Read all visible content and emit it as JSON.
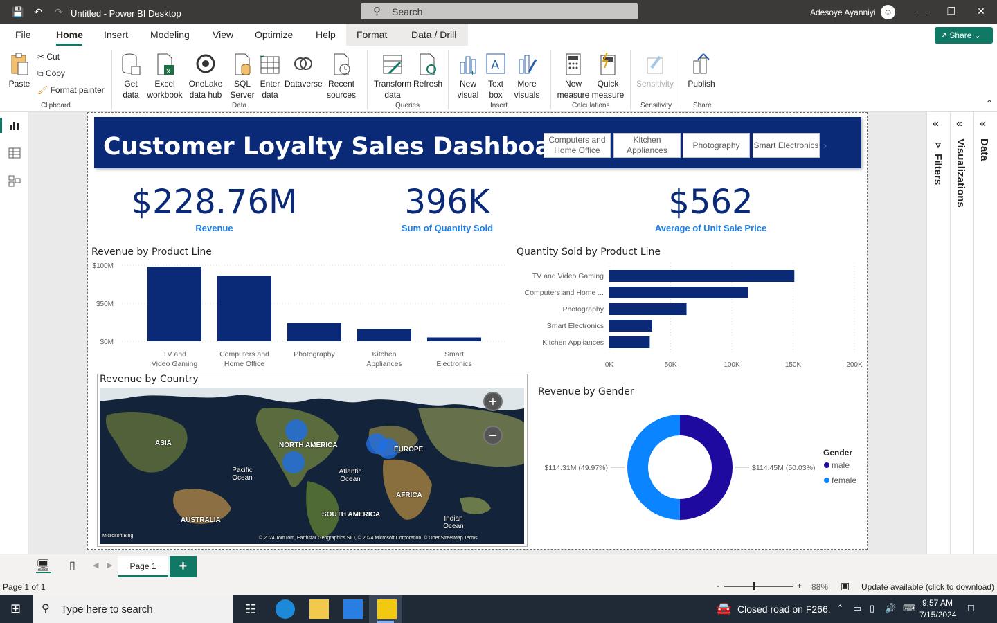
{
  "app": {
    "title": "Untitled - Power BI Desktop",
    "search_placeholder": "Search",
    "user": "Adesoye Ayanniyi"
  },
  "menu": {
    "items": [
      "File",
      "Home",
      "Insert",
      "Modeling",
      "View",
      "Optimize",
      "Help",
      "Format",
      "Data / Drill"
    ],
    "active": "Home",
    "share_label": "Share"
  },
  "ribbon": {
    "clipboard": {
      "paste": "Paste",
      "cut": "Cut",
      "copy": "Copy",
      "format_painter": "Format painter",
      "group": "Clipboard"
    },
    "data": {
      "get_data": "Get data",
      "excel": "Excel workbook",
      "onelake": "OneLake data hub",
      "sql": "SQL Server",
      "enter": "Enter data",
      "dataverse": "Dataverse",
      "recent": "Recent sources",
      "group": "Data"
    },
    "queries": {
      "transform": "Transform data",
      "refresh": "Refresh",
      "group": "Queries"
    },
    "insert": {
      "new_visual": "New visual",
      "text_box": "Text box",
      "more_visuals": "More visuals",
      "group": "Insert"
    },
    "calculations": {
      "new_measure": "New measure",
      "quick_measure": "Quick measure",
      "group": "Calculations"
    },
    "sensitivity": {
      "label": "Sensitivity",
      "group": "Sensitivity"
    },
    "share": {
      "publish": "Publish",
      "group": "Share"
    }
  },
  "report": {
    "title": "Customer Loyalty Sales Dashboard",
    "slicers": [
      "Computers and Home Office",
      "Kitchen Appliances",
      "Photography",
      "Smart Electronics"
    ],
    "kpis": [
      {
        "value": "$228.76M",
        "label": "Revenue"
      },
      {
        "value": "396K",
        "label": "Sum of Quantity Sold"
      },
      {
        "value": "$562",
        "label": "Average of Unit Sale Price"
      }
    ],
    "revenue_by_product_title": "Revenue by Product Line",
    "quantity_by_product_title": "Quantity Sold by Product Line",
    "revenue_by_country_title": "Revenue by Country",
    "revenue_by_gender_title": "Revenue by Gender",
    "gender_legend_title": "Gender",
    "map": {
      "labels": [
        "ASIA",
        "NORTH AMERICA",
        "EUROPE",
        "Pacific Ocean",
        "Atlantic Ocean",
        "AFRICA",
        "SOUTH AMERICA",
        "AUSTRALIA",
        "Indian Ocean"
      ],
      "bing": "Microsoft Bing",
      "credits": "© 2024 TomTom, Earthstar Geographics SIO, © 2024 Microsoft Corporation, © OpenStreetMap  Terms"
    }
  },
  "chart_data": [
    {
      "type": "bar",
      "title": "Revenue by Product Line",
      "categories": [
        "TV and Video Gaming",
        "Computers and Home Office",
        "Photography",
        "Kitchen Appliances",
        "Smart Electronics"
      ],
      "values": [
        98,
        86,
        24,
        16,
        5
      ],
      "unit": "$M",
      "yticks": [
        "$0M",
        "$50M",
        "$100M"
      ],
      "ylim": [
        0,
        100
      ],
      "color": "#0a2a78"
    },
    {
      "type": "bar",
      "orientation": "horizontal",
      "title": "Quantity Sold by Product Line",
      "categories": [
        "TV and Video Gaming",
        "Computers and Home ...",
        "Photography",
        "Smart Electronics",
        "Kitchen Appliances"
      ],
      "values": [
        151000,
        113000,
        63000,
        35000,
        33000
      ],
      "xticks": [
        "0K",
        "50K",
        "100K",
        "150K",
        "200K"
      ],
      "xlim": [
        0,
        200000
      ],
      "color": "#0a2a78"
    },
    {
      "type": "pie",
      "donut": true,
      "title": "Revenue by Gender",
      "legend_title": "Gender",
      "slices": [
        {
          "name": "male",
          "value": 50.03,
          "label": "$114.45M (50.03%)",
          "color": "#1e0a9e"
        },
        {
          "name": "female",
          "value": 49.97,
          "label": "$114.31M (49.97%)",
          "color": "#0a84ff"
        }
      ]
    }
  ],
  "pages": {
    "tab": "Page 1",
    "add": "+"
  },
  "status": {
    "page": "Page 1 of 1",
    "zoom": "88%",
    "update": "Update available (click to download)"
  },
  "taskbar": {
    "search": "Type here to search",
    "notification": "Closed road on F266.",
    "time": "9:57 AM",
    "date": "7/15/2024"
  }
}
